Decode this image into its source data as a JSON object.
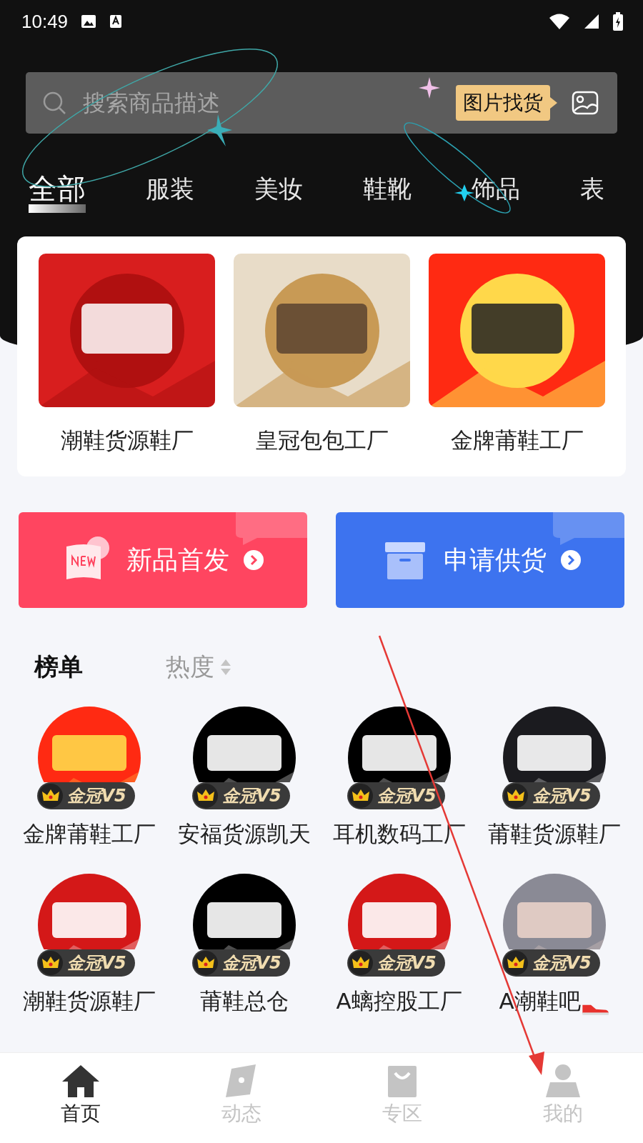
{
  "status_bar": {
    "time": "10:49"
  },
  "search": {
    "placeholder": "搜索商品描述",
    "image_search_label": "图片找货"
  },
  "categories": [
    {
      "label": "全部",
      "selected": true
    },
    {
      "label": "服装",
      "selected": false
    },
    {
      "label": "美妆",
      "selected": false
    },
    {
      "label": "鞋靴",
      "selected": false
    },
    {
      "label": "饰品",
      "selected": false
    },
    {
      "label": "表",
      "selected": false
    }
  ],
  "featured": [
    {
      "name": "潮鞋货源鞋厂"
    },
    {
      "name": "皇冠包包工厂"
    },
    {
      "name": "金牌莆鞋工厂"
    }
  ],
  "promo_buttons": [
    {
      "kind": "new",
      "label": "新品首发"
    },
    {
      "kind": "supply",
      "label": "申请供货"
    }
  ],
  "ranking": {
    "title": "榜单",
    "sort_label": "热度",
    "shops": [
      {
        "name": "金牌莆鞋工厂",
        "badge": "金冠V5",
        "shoe_icon": false
      },
      {
        "name": "安福货源凯天",
        "badge": "金冠V5",
        "shoe_icon": false
      },
      {
        "name": "耳机数码工厂",
        "badge": "金冠V5",
        "shoe_icon": false
      },
      {
        "name": "莆鞋货源鞋厂",
        "badge": "金冠V5",
        "shoe_icon": false
      },
      {
        "name": "潮鞋货源鞋厂",
        "badge": "金冠V5",
        "shoe_icon": false
      },
      {
        "name": "莆鞋总仓",
        "badge": "金冠V5",
        "shoe_icon": false
      },
      {
        "name": "A螭控股工厂",
        "badge": "金冠V5",
        "shoe_icon": false
      },
      {
        "name": "A潮鞋吧",
        "badge": "金冠V5",
        "shoe_icon": true
      }
    ]
  },
  "bottom_nav": [
    {
      "kind": "home",
      "label": "首页",
      "selected": true
    },
    {
      "kind": "feed",
      "label": "动态",
      "selected": false
    },
    {
      "kind": "zone",
      "label": "专区",
      "selected": false
    },
    {
      "kind": "me",
      "label": "我的",
      "selected": false
    }
  ]
}
